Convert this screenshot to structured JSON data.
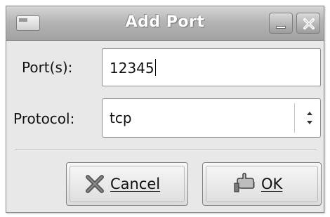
{
  "window": {
    "title": "Add Port"
  },
  "form": {
    "port_label": "Port(s):",
    "port_value": "12345",
    "protocol_label": "Protocol:",
    "protocol_value": "tcp"
  },
  "buttons": {
    "cancel_label": "Cancel",
    "ok_label": "OK"
  },
  "icons": {
    "window": "window-icon",
    "minimize": "minimize-icon",
    "close": "close-icon",
    "combo_arrows": "up-down-arrows-icon",
    "cancel": "cancel-x-icon",
    "ok": "ok-hand-icon"
  }
}
